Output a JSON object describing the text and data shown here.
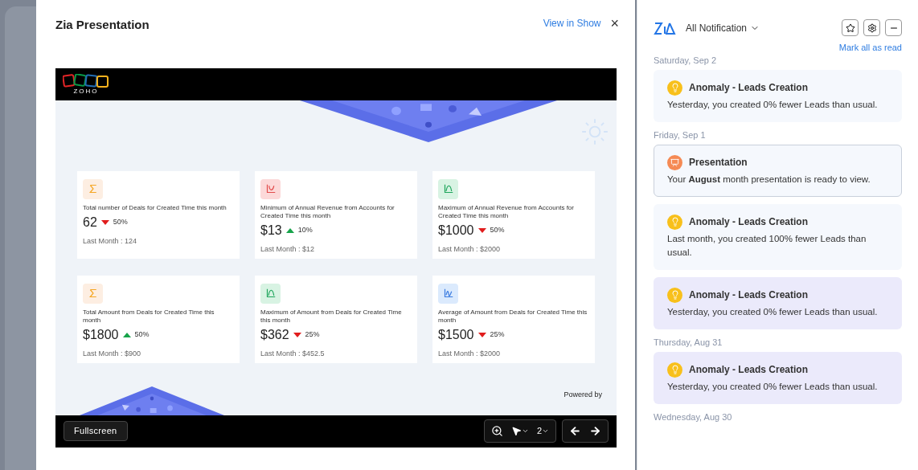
{
  "modal": {
    "title": "Zia Presentation",
    "view_link": "View in Show",
    "close": "×"
  },
  "slide": {
    "logo_text": "ZOHO",
    "powered_by": "Powered by",
    "cards": [
      {
        "kind": "sum",
        "title": "Total number of Deals for Created Time this month",
        "value": "62",
        "rising": false,
        "change": "50%",
        "last": "Last Month : 124"
      },
      {
        "kind": "min",
        "title": "Minimum of Annual Revenue from Accounts for Created Time this month",
        "value": "$13",
        "rising": true,
        "change": "10%",
        "last": "Last Month : $12"
      },
      {
        "kind": "max",
        "title": "Maximum of Annual Revenue from Accounts for Created Time this month",
        "value": "$1000",
        "rising": false,
        "change": "50%",
        "last": "Last Month : $2000"
      },
      {
        "kind": "sum",
        "title": "Total Amount from Deals for Created Time this month",
        "value": "$1800",
        "rising": true,
        "change": "50%",
        "last": "Last Month : $900"
      },
      {
        "kind": "max",
        "title": "Maximum of Amount from Deals for Created Time this month",
        "value": "$362",
        "rising": false,
        "change": "25%",
        "last": "Last Month : $452.5"
      },
      {
        "kind": "avg",
        "title": "Average of Amount from Deals for Created Time this month",
        "value": "$1500",
        "rising": false,
        "change": "25%",
        "last": "Last Month : $2000"
      }
    ]
  },
  "toolbar": {
    "fullscreen": "Fullscreen",
    "page": "2"
  },
  "notifications": {
    "filter": "All Notification",
    "mark_all": "Mark all as read",
    "groups": [
      {
        "date": "Saturday, Sep 2",
        "items": [
          {
            "kind": "anomaly",
            "title": "Anomaly - Leads Creation",
            "text": "Yesterday, you created 0% fewer Leads than usual.",
            "unread": false,
            "selected": false
          }
        ]
      },
      {
        "date": "Friday, Sep 1",
        "items": [
          {
            "kind": "presentation",
            "title": "Presentation",
            "text": "Your **August** month presentation is ready to view.",
            "unread": false,
            "selected": true
          },
          {
            "kind": "anomaly",
            "title": "Anomaly - Leads Creation",
            "text": "Last month, you created 100% fewer Leads than usual.",
            "unread": false,
            "selected": false
          },
          {
            "kind": "anomaly",
            "title": "Anomaly - Leads Creation",
            "text": "Yesterday, you created 0% fewer Leads than usual.",
            "unread": true,
            "selected": false
          }
        ]
      },
      {
        "date": "Thursday, Aug 31",
        "items": [
          {
            "kind": "anomaly",
            "title": "Anomaly - Leads Creation",
            "text": "Yesterday, you created 0% fewer Leads than usual.",
            "unread": true,
            "selected": false
          }
        ]
      },
      {
        "date": "Wednesday, Aug 30"
      }
    ]
  }
}
